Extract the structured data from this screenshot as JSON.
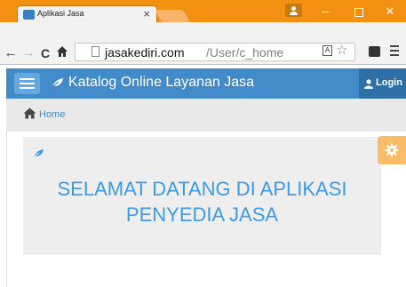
{
  "browser": {
    "tab_title": "Aplikasi Jasa",
    "tab_close": "×",
    "url_host": "jasakediri.com",
    "url_path": "/User/c_home",
    "close_glyph": "✕",
    "back_glyph": "←",
    "forward_glyph": "→",
    "reload_glyph": "C",
    "home_glyph": "🏠",
    "star_glyph": "☆",
    "translate_glyph": "A"
  },
  "navbar": {
    "brand": "Katalog Online Layanan Jasa",
    "login_label": "Login",
    "color": "#418bca"
  },
  "breadcrumb": {
    "home_label": "Home"
  },
  "welcome": {
    "line1": "SELAMAT DATANG DI APLIKASI",
    "line2": "PENYEDIA JASA",
    "color": "#3d9ae8"
  },
  "colors": {
    "titlebar": "#f29111",
    "gear_button": "#fbbc68"
  },
  "icons": [
    "menu-icon",
    "leaf-icon",
    "user-icon",
    "home-icon",
    "gear-icon",
    "star-icon"
  ]
}
